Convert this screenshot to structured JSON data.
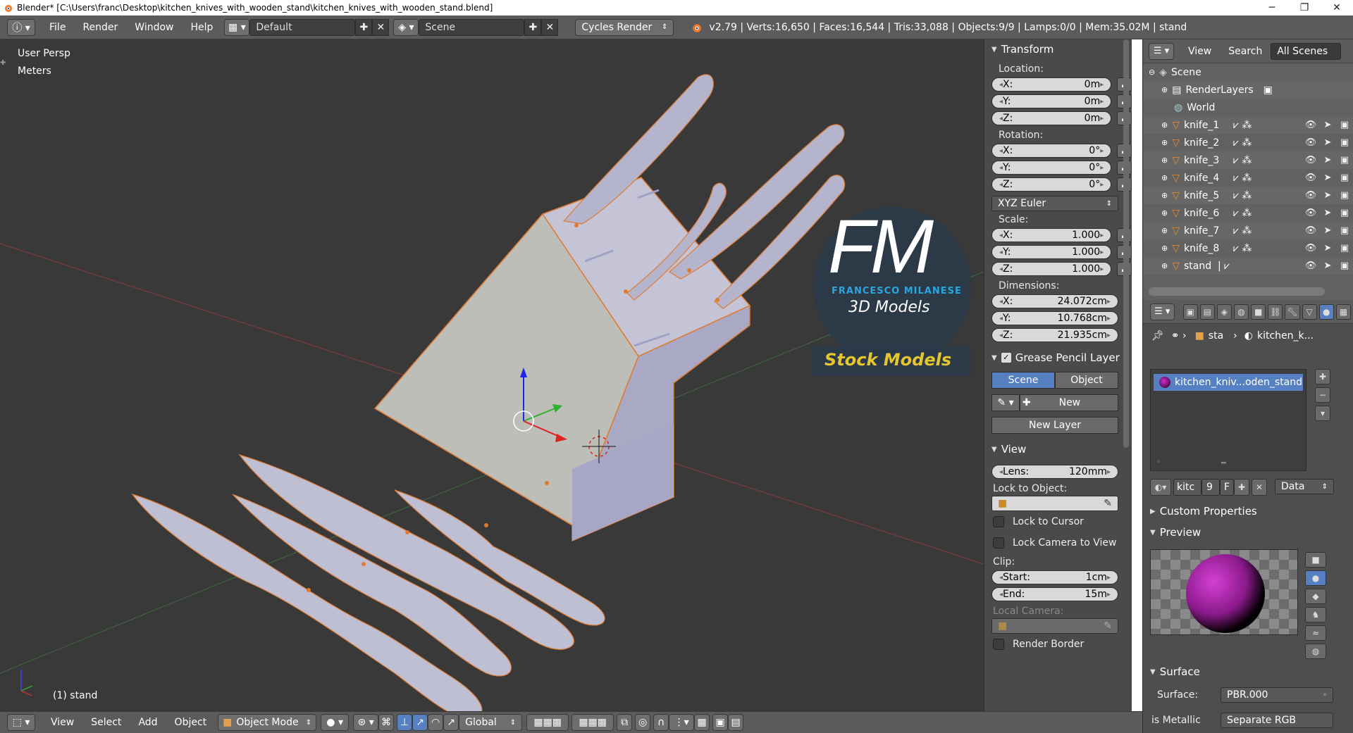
{
  "window": {
    "title": "Blender* [C:\\Users\\franc\\Desktop\\kitchen_knives_with_wooden_stand\\kitchen_knives_with_wooden_stand.blend]",
    "minimize": "─",
    "maximize": "❐",
    "close": "✕"
  },
  "infobar": {
    "menus": [
      "File",
      "Render",
      "Window",
      "Help"
    ],
    "screen_layout": "Default",
    "scene": "Scene",
    "render_engine": "Cycles Render",
    "stats": "v2.79 | Verts:16,650 | Faces:16,544 | Tris:33,088 | Objects:9/9 | Lamps:0/0 | Mem:35.02M | stand"
  },
  "viewport": {
    "view_name": "User Persp",
    "units": "Meters",
    "selected_object": "(1) stand",
    "watermark": {
      "logo": "FM",
      "brand": "FRANCESCO MILANESE",
      "tagline": "3D Models",
      "banner": "Stock Models"
    }
  },
  "npanel": {
    "transform": {
      "header": "Transform",
      "location_label": "Location:",
      "location": [
        {
          "axis": "X:",
          "value": "0m"
        },
        {
          "axis": "Y:",
          "value": "0m"
        },
        {
          "axis": "Z:",
          "value": "0m"
        }
      ],
      "rotation_label": "Rotation:",
      "rotation": [
        {
          "axis": "X:",
          "value": "0°"
        },
        {
          "axis": "Y:",
          "value": "0°"
        },
        {
          "axis": "Z:",
          "value": "0°"
        }
      ],
      "rotation_mode": "XYZ Euler",
      "scale_label": "Scale:",
      "scale": [
        {
          "axis": "X:",
          "value": "1.000"
        },
        {
          "axis": "Y:",
          "value": "1.000"
        },
        {
          "axis": "Z:",
          "value": "1.000"
        }
      ],
      "dimensions_label": "Dimensions:",
      "dimensions": [
        {
          "axis": "X:",
          "value": "24.072cm"
        },
        {
          "axis": "Y:",
          "value": "10.768cm"
        },
        {
          "axis": "Z:",
          "value": "21.935cm"
        }
      ]
    },
    "grease_pencil": {
      "header": "Grease Pencil Layer",
      "tab_scene": "Scene",
      "tab_object": "Object",
      "new_label": "New",
      "new_layer_label": "New Layer"
    },
    "view": {
      "header": "View",
      "lens_label": "Lens:",
      "lens_value": "120mm",
      "lock_to_object_label": "Lock to Object:",
      "lock_to_cursor": "Lock to Cursor",
      "lock_camera": "Lock Camera to View",
      "clip_label": "Clip:",
      "clip_start_label": "Start:",
      "clip_start": "1cm",
      "clip_end_label": "End:",
      "clip_end": "15m",
      "local_camera_label": "Local Camera:",
      "render_border": "Render Border"
    }
  },
  "outliner": {
    "menus": [
      "View",
      "Search"
    ],
    "filter": "All Scenes",
    "scene": "Scene",
    "items": [
      "RenderLayers",
      "World",
      "knife_1",
      "knife_2",
      "knife_3",
      "knife_4",
      "knife_5",
      "knife_6",
      "knife_7",
      "knife_8",
      "stand"
    ]
  },
  "properties": {
    "breadcrumb_object": "sta",
    "breadcrumb_material": "kitchen_k...",
    "material_slot": "kitchen_kniv...oden_stand",
    "material_name": "kitc",
    "users": "9",
    "fake_user": "F",
    "link": "Data",
    "custom_properties": "Custom Properties",
    "preview": "Preview",
    "surface_header": "Surface",
    "surface_label": "Surface:",
    "surface_value": "PBR.000",
    "is_metallic": "is Metallic",
    "is_metallic_value": "Separate RGB"
  },
  "bottombar": {
    "menus": [
      "View",
      "Select",
      "Add",
      "Object"
    ],
    "mode": "Object Mode",
    "orientation": "Global"
  },
  "colors": {
    "accent": "#5680c2",
    "viewport_bg": "#393939",
    "header_bg": "#5b5b5b",
    "mesh": "#c3c3d6",
    "selection_outline": "#e07a2f",
    "logo_cyan": "#2aa6e0",
    "banner_yellow": "#e6c62e"
  }
}
